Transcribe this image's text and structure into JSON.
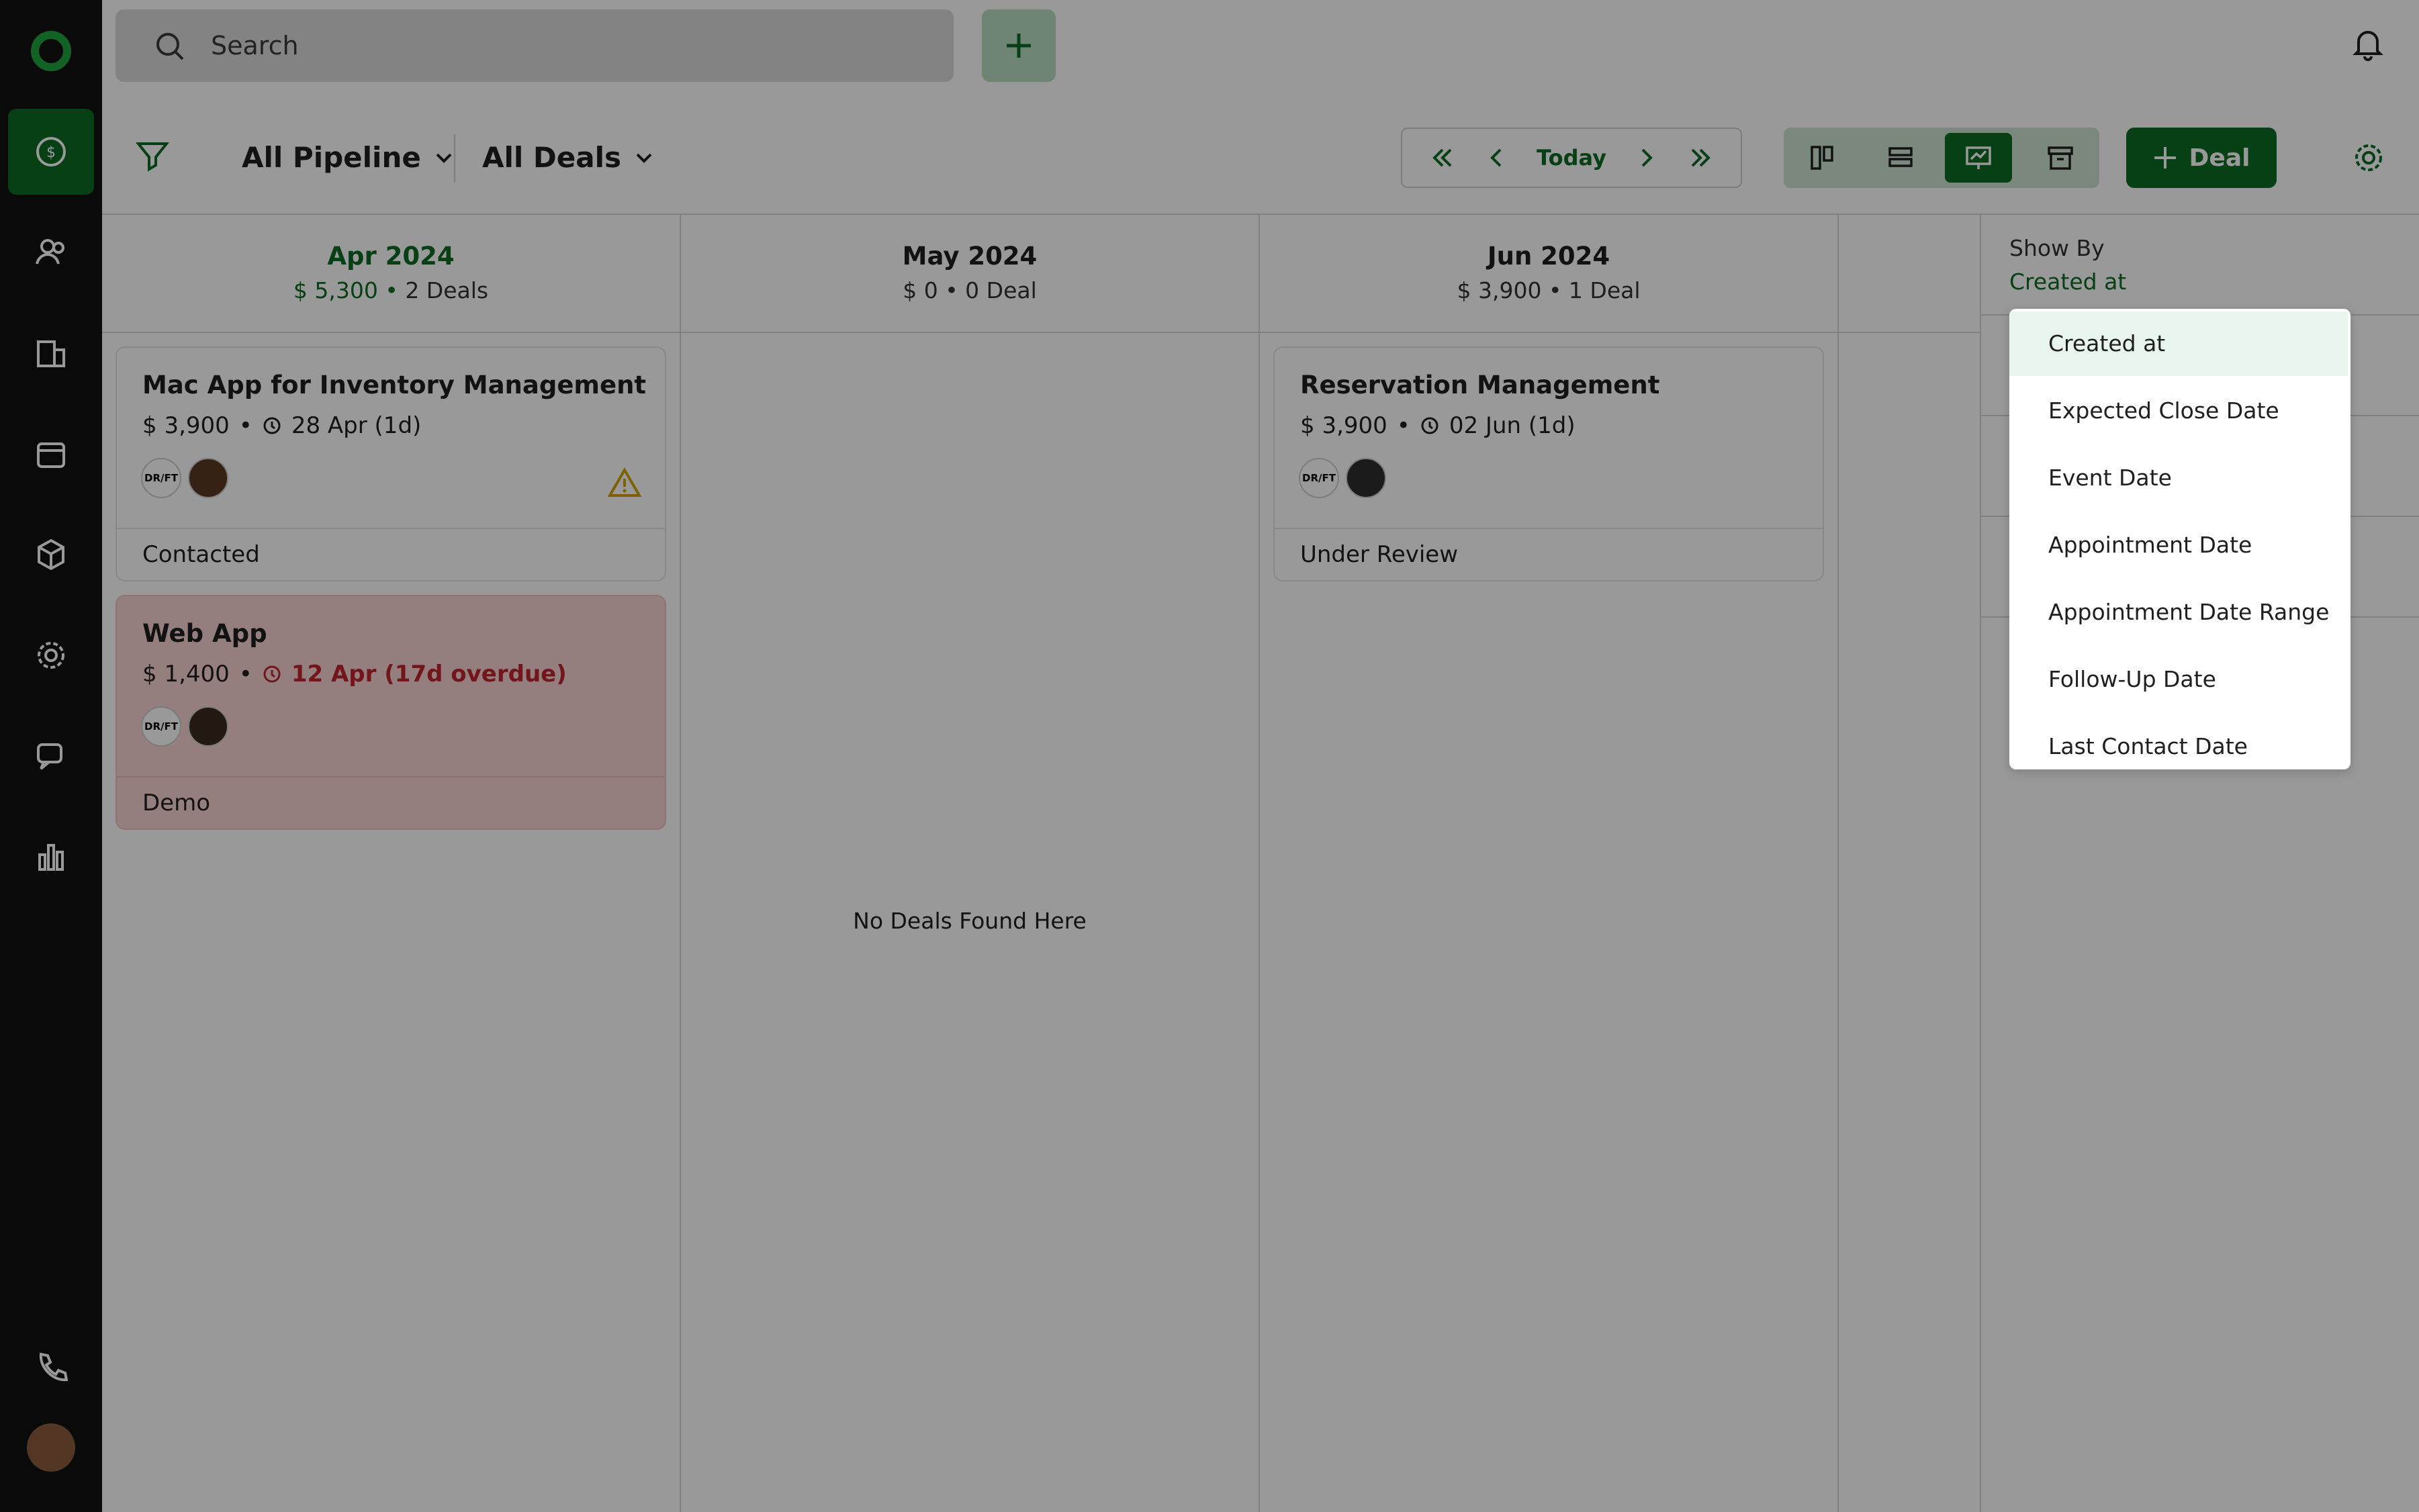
{
  "search": {
    "label": "Search"
  },
  "toolbar": {
    "pipeline_label": "All Pipeline",
    "deals_filter_label": "All Deals",
    "today_label": "Today",
    "add_deal_label": "Deal"
  },
  "columns": [
    {
      "title": "Apr 2024",
      "amount": "$ 5,300",
      "count": "2 Deals"
    },
    {
      "title": "May 2024",
      "amount": "$ 0",
      "count": "0 Deal"
    },
    {
      "title": "Jun 2024",
      "amount": "$ 3,900",
      "count": "1 Deal"
    }
  ],
  "cards": [
    {
      "name": "Mac App for Inventory Management",
      "amount": "$ 3,900",
      "date": "28 Apr (1d)",
      "stage": "Contacted",
      "logo_text": "DR/FT"
    },
    {
      "name": "Web App",
      "amount": "$ 1,400",
      "date": "12 Apr (17d overdue)",
      "stage": "Demo",
      "logo_text": "DR/FT"
    },
    {
      "name": "Reservation Management",
      "amount": "$ 3,900",
      "date": "02 Jun (1d)",
      "stage": "Under Review",
      "logo_text": "DR/FT"
    }
  ],
  "empty_state": "No Deals Found Here",
  "show_by": {
    "label": "Show By",
    "value": "Created at",
    "options": [
      "Created at",
      "Expected Close Date",
      "Event Date",
      "Appointment Date",
      "Appointment Date Range",
      "Follow-Up Date",
      "Last Contact Date"
    ]
  },
  "colors": {
    "brand": "#0b6b22",
    "overdue": "#c0262d",
    "warning": "#d1a400"
  },
  "icons": [
    "logo-icon",
    "deals-icon",
    "contacts-icon",
    "companies-icon",
    "calendar-icon",
    "products-icon",
    "settings-icon",
    "chat-icon",
    "reports-icon",
    "phone-icon",
    "search-icon",
    "plus-icon",
    "bell-icon",
    "filter-icon",
    "chevron-down-icon",
    "double-left-icon",
    "left-icon",
    "right-icon",
    "double-right-icon",
    "kanban-view-icon",
    "list-view-icon",
    "timeline-view-icon",
    "archive-icon",
    "gear-icon",
    "clock-icon",
    "warning-icon"
  ]
}
